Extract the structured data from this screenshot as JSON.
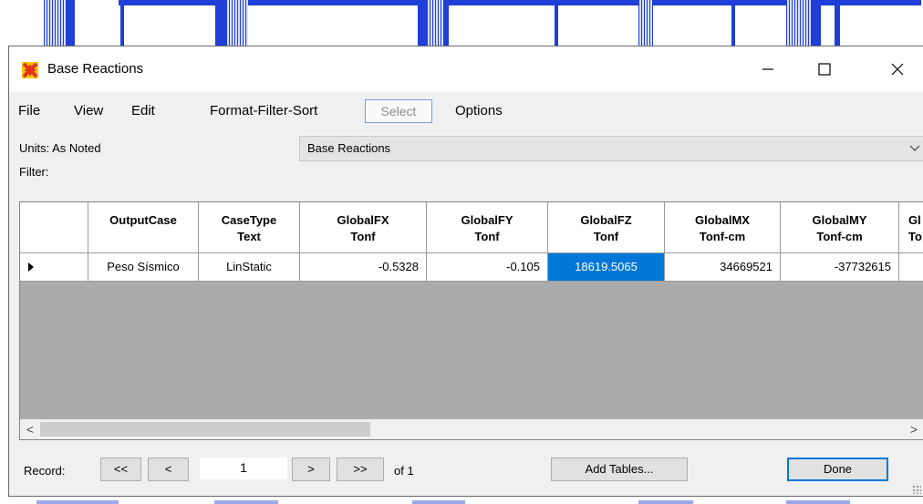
{
  "window": {
    "title": "Base Reactions",
    "controls": {
      "minimize": "—",
      "maximize": "☐",
      "close": "✕"
    }
  },
  "menu": {
    "items": [
      "File",
      "View",
      "Edit",
      "Format-Filter-Sort",
      "Select",
      "Options"
    ]
  },
  "info": {
    "units_label": "Units:  As Noted",
    "filter_label": "Filter:",
    "table_select_value": "Base Reactions"
  },
  "table": {
    "headers": [
      [
        "OutputCase",
        ""
      ],
      [
        "CaseType",
        "Text"
      ],
      [
        "GlobalFX",
        "Tonf"
      ],
      [
        "GlobalFY",
        "Tonf"
      ],
      [
        "GlobalFZ",
        "Tonf"
      ],
      [
        "GlobalMX",
        "Tonf-cm"
      ],
      [
        "GlobalMY",
        "Tonf-cm"
      ],
      [
        "Gl",
        "To"
      ]
    ],
    "rows": [
      [
        "Peso Sísmico",
        "LinStatic",
        "-0.5328",
        "-0.105",
        "18619.5065",
        "34669521",
        "-37732615",
        ""
      ]
    ],
    "selected_column": "GlobalFZ"
  },
  "scrollbar": {
    "left_arrow": "<",
    "right_arrow": ">"
  },
  "footer": {
    "record_label": "Record:",
    "first": "<<",
    "prev": "<",
    "current_record": "1",
    "next": ">",
    "last": ">>",
    "of_total": "of 1",
    "add_tables": "Add Tables...",
    "done": "Done"
  },
  "colors": {
    "selection": "#0078d7",
    "model_lines": "#1f3fd8",
    "grid_empty": "#ababab"
  }
}
